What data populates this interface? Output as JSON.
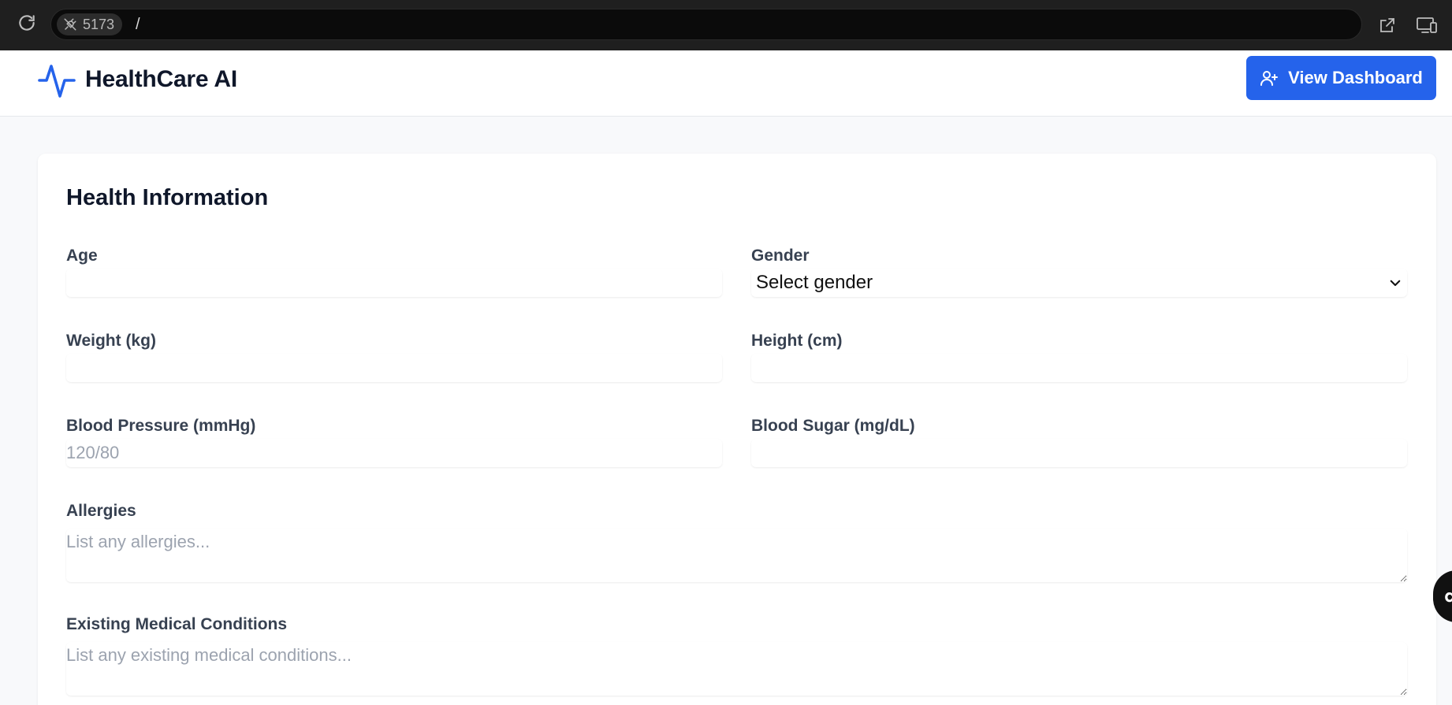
{
  "browser": {
    "port": "5173",
    "path": "/"
  },
  "app": {
    "brand": "HealthCare AI",
    "dashboard_button": "View Dashboard",
    "accent_color": "#2563eb"
  },
  "form": {
    "title": "Health Information",
    "age": {
      "label": "Age",
      "value": "",
      "placeholder": ""
    },
    "gender": {
      "label": "Gender",
      "selected": "Select gender"
    },
    "weight": {
      "label": "Weight (kg)",
      "value": "",
      "placeholder": ""
    },
    "height": {
      "label": "Height (cm)",
      "value": "",
      "placeholder": ""
    },
    "blood_pressure": {
      "label": "Blood Pressure (mmHg)",
      "placeholder": "120/80"
    },
    "blood_sugar": {
      "label": "Blood Sugar (mg/dL)",
      "placeholder": ""
    },
    "allergies": {
      "label": "Allergies",
      "placeholder": "List any allergies..."
    },
    "conditions": {
      "label": "Existing Medical Conditions",
      "placeholder": "List any existing medical conditions..."
    }
  }
}
